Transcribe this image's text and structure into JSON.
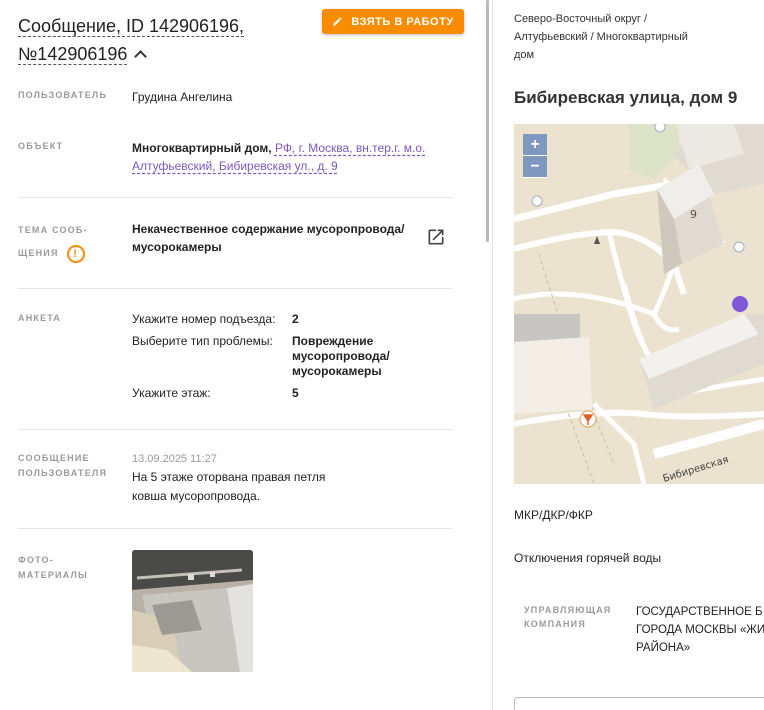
{
  "message": {
    "title_line1": "Сообщение, ID 142906196,",
    "title_line2": "№142906196"
  },
  "actions": {
    "take_to_work": "ВЗЯТЬ В РАБОТУ"
  },
  "fields": {
    "user_label": "ПОЛЬЗОВАТЕЛЬ",
    "user_value": "Грудина Ангелина",
    "object_label": "ОБЪЕКТ",
    "object_type": "Многоквартирный дом,",
    "object_address_line1": "РФ, г. Москва, вн.тер.г. м.о.",
    "object_address_line2": "Алтуфьевский, Бибиревская ул., д. 9",
    "topic_label_line1": "ТЕМА СООБ-",
    "topic_label_line2": "ЩЕНИЯ",
    "topic_warning": "!",
    "topic_value_line1": "Некачественное содержание мусоропровода/",
    "topic_value_line2": "мусорокамеры",
    "survey_label": "АНКЕТА",
    "survey": [
      {
        "q": "Укажите номер подъезда:",
        "a": "2"
      },
      {
        "q": "Выберите тип проблемы:",
        "a_line1": "Повреждение",
        "a_line2": "мусоропровода/",
        "a_line3": "мусорокамеры"
      },
      {
        "q": "Укажите этаж:",
        "a": "5"
      }
    ],
    "message_label_line1": "СООБЩЕНИЕ",
    "message_label_line2": "ПОЛЬЗОВАТЕЛЯ",
    "message_date": "13.09.2025 11:27",
    "message_text_line1": "На 5 этаже оторвана правая петля",
    "message_text_line2": "ковша мусоропровода.",
    "photos_label_line1": "ФОТО-",
    "photos_label_line2": "МАТЕРИАЛЫ"
  },
  "right": {
    "breadcrumb_line1": "Северо-Восточный округ /",
    "breadcrumb_line2": "Алтуфьевский / Многоквартирный",
    "breadcrumb_line3": "дом",
    "address": "Бибиревская улица, дом 9",
    "map": {
      "zoom_in": "+",
      "zoom_out": "−",
      "building_number": "9",
      "street_label": "Бибиревская"
    },
    "mkr": "МКР/ДКР/ФКР",
    "hot_water": "Отключения горячей воды",
    "management_label_line1": "УПРАВЛЯЮЩАЯ",
    "management_label_line2": "КОМПАНИЯ",
    "management_line1": "ГОСУДАРСТВЕННОЕ Б",
    "management_line2": "ГОРОДА МОСКВЫ «ЖИ",
    "management_line3": "РАЙОНА»"
  },
  "colors": {
    "accent": "#fb8c00",
    "link": "#7e57c2",
    "map_marker": "#7e57d6"
  }
}
